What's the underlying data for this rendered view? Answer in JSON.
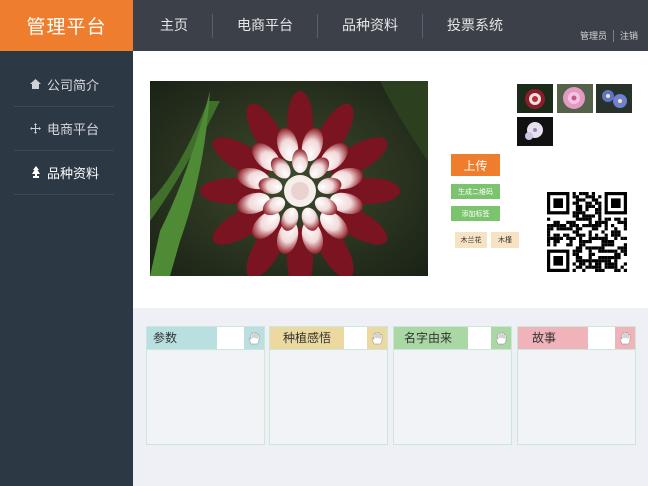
{
  "app": {
    "title": "管理平台"
  },
  "topnav": {
    "items": [
      "主页",
      "电商平台",
      "品种资料",
      "投票系统"
    ]
  },
  "user": {
    "name": "管理员",
    "logout": "注销"
  },
  "sidebar": {
    "items": [
      {
        "label": "公司简介",
        "icon": "home-icon"
      },
      {
        "label": "电商平台",
        "icon": "move-icon"
      },
      {
        "label": "品种资料",
        "icon": "tree-icon"
      }
    ],
    "active": "品种资料"
  },
  "upload": {
    "label": "上传"
  },
  "actions": {
    "qr_label": "生成二维码",
    "tag_label": "添加标签"
  },
  "tags": [
    "木兰花",
    "木槿"
  ],
  "cards": [
    {
      "title": "参数",
      "color": "#b9dfe0"
    },
    {
      "title": "种植感悟",
      "color": "#ecd9a0"
    },
    {
      "title": "名字由来",
      "color": "#a9d8a4"
    },
    {
      "title": "故事",
      "color": "#f0b3ba"
    }
  ],
  "colors": {
    "accent": "#ee7d2d",
    "green": "#7cc36e",
    "sidebar": "#2d3845",
    "topbar": "#3c4049"
  }
}
